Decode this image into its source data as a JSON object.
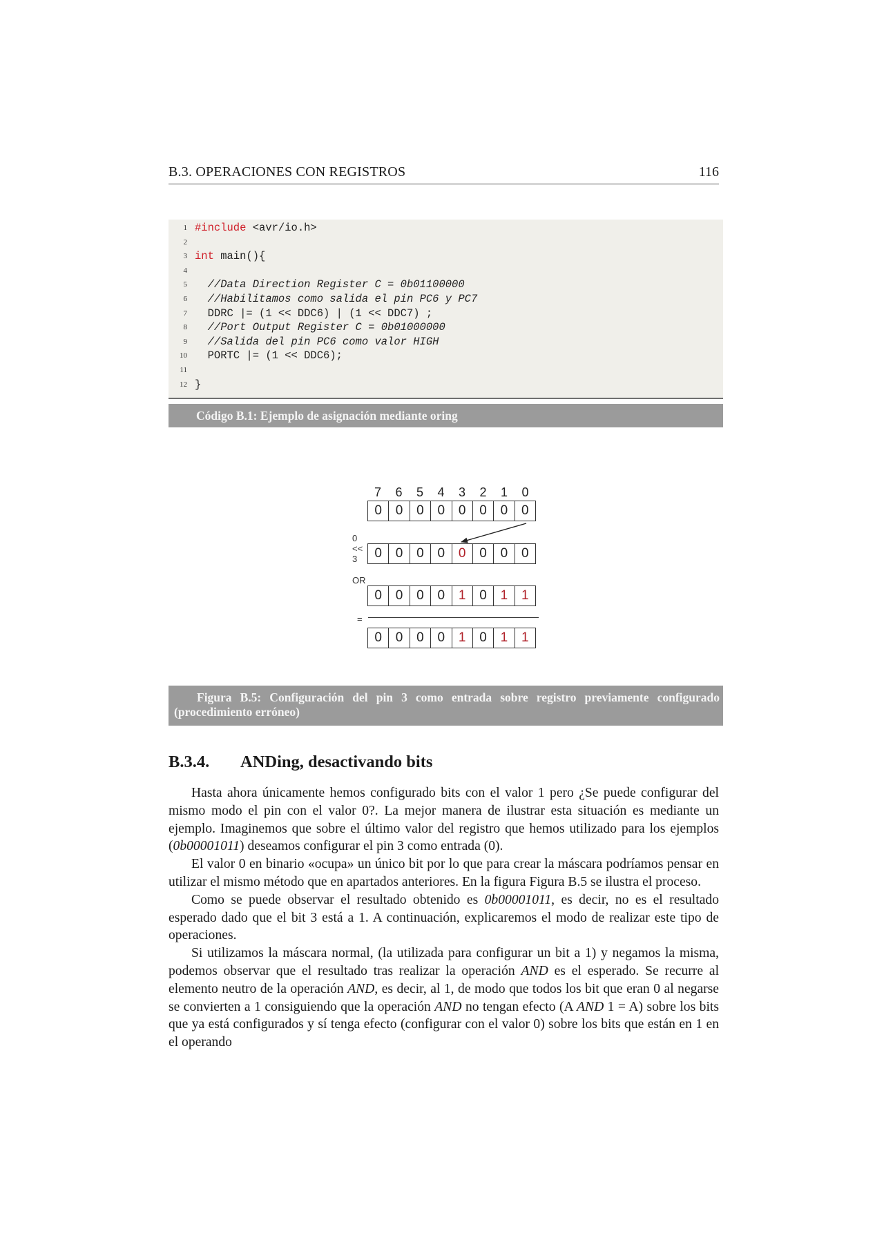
{
  "header": {
    "title": "B.3.  OPERACIONES CON REGISTROS",
    "page_number": "116"
  },
  "code": {
    "lines": [
      {
        "n": "1",
        "parts": [
          {
            "t": "#include",
            "k": "kw"
          },
          {
            "t": " <avr/io.h>",
            "k": ""
          }
        ]
      },
      {
        "n": "2",
        "parts": []
      },
      {
        "n": "3",
        "parts": [
          {
            "t": "int",
            "k": "kw"
          },
          {
            "t": " main(){",
            "k": ""
          }
        ]
      },
      {
        "n": "4",
        "parts": []
      },
      {
        "n": "5",
        "parts": [
          {
            "t": "  //Data Direction Register C = 0b01100000",
            "k": "cm"
          }
        ]
      },
      {
        "n": "6",
        "parts": [
          {
            "t": "  //Habilitamos como salida el pin PC6 y PC7",
            "k": "cm"
          }
        ]
      },
      {
        "n": "7",
        "parts": [
          {
            "t": "  DDRC |= (1 << DDC6) | (1 << DDC7) ;",
            "k": ""
          }
        ]
      },
      {
        "n": "8",
        "parts": [
          {
            "t": "  //Port Output Register C = 0b01000000",
            "k": "cm"
          }
        ]
      },
      {
        "n": "9",
        "parts": [
          {
            "t": "  //Salida del pin PC6 como valor HIGH",
            "k": "cm"
          }
        ]
      },
      {
        "n": "10",
        "parts": [
          {
            "t": "  PORTC |= (1 << DDC6);",
            "k": ""
          }
        ]
      },
      {
        "n": "11",
        "parts": []
      },
      {
        "n": "12",
        "parts": [
          {
            "t": "}",
            "k": ""
          }
        ]
      }
    ],
    "caption": "Código B.1: Ejemplo de asignación mediante oring"
  },
  "figure": {
    "bit_indices": [
      "7",
      "6",
      "5",
      "4",
      "3",
      "2",
      "1",
      "0"
    ],
    "rows": [
      {
        "bits": [
          "0",
          "0",
          "0",
          "0",
          "0",
          "0",
          "0",
          "0"
        ],
        "highlight": []
      },
      {
        "bits": [
          "0",
          "0",
          "0",
          "0",
          "0",
          "0",
          "0",
          "0"
        ],
        "highlight": [
          4
        ]
      },
      {
        "bits": [
          "0",
          "0",
          "0",
          "0",
          "1",
          "0",
          "1",
          "1"
        ],
        "highlight": [
          4,
          6,
          7
        ]
      },
      {
        "bits": [
          "0",
          "0",
          "0",
          "0",
          "1",
          "0",
          "1",
          "1"
        ],
        "highlight": [
          4,
          6,
          7
        ]
      }
    ],
    "labels": {
      "shift": "0 << 3",
      "or": "OR",
      "equals": "="
    },
    "highlight_color": "#b0222a",
    "caption": "Figura B.5: Configuración del pin 3 como entrada sobre registro previamente configurado (procedimiento erróneo)"
  },
  "section": {
    "number": "B.3.4.",
    "title": "ANDing, desactivando bits"
  },
  "paragraphs": [
    [
      {
        "t": "Hasta ahora únicamente hemos configurado bits con el valor 1 pero ¿Se puede configurar del mismo modo el pin con el valor 0?. La mejor manera de ilustrar esta situación es mediante un ejemplo. Imaginemos que sobre el último valor del registro que hemos utilizado para los ejemplos (",
        "i": false
      },
      {
        "t": "0b00001011",
        "i": true
      },
      {
        "t": ") deseamos configurar el pin 3 como entrada (0).",
        "i": false
      }
    ],
    [
      {
        "t": "El valor 0 en binario «ocupa» un único bit por lo que para crear la máscara podríamos pensar en utilizar el mismo método que en apartados anteriores. En la figura Figura B.5 se ilustra el proceso.",
        "i": false
      }
    ],
    [
      {
        "t": "Como se puede observar el resultado obtenido es ",
        "i": false
      },
      {
        "t": "0b00001011",
        "i": true
      },
      {
        "t": ", es decir, no es el resultado esperado dado que el bit 3 está a 1. A continuación, explicaremos el modo de realizar este tipo de operaciones.",
        "i": false
      }
    ],
    [
      {
        "t": "Si utilizamos la máscara normal, (la utilizada para configurar un bit a 1) y negamos la misma, podemos observar que el resultado tras realizar la operación ",
        "i": false
      },
      {
        "t": "AND",
        "i": true
      },
      {
        "t": " es el esperado. Se recurre al elemento neutro de la operación ",
        "i": false
      },
      {
        "t": "AND",
        "i": true
      },
      {
        "t": ", es decir, al 1, de modo que todos los bit que eran 0 al negarse se convierten a 1 consiguiendo que la operación ",
        "i": false
      },
      {
        "t": "AND",
        "i": true
      },
      {
        "t": " no tengan efecto (A ",
        "i": false
      },
      {
        "t": "AND",
        "i": true
      },
      {
        "t": " 1 = A) sobre los bits que ya está configurados y sí tenga efecto (configurar con el valor 0) sobre los bits que están en 1 en el operando",
        "i": false
      }
    ]
  ]
}
